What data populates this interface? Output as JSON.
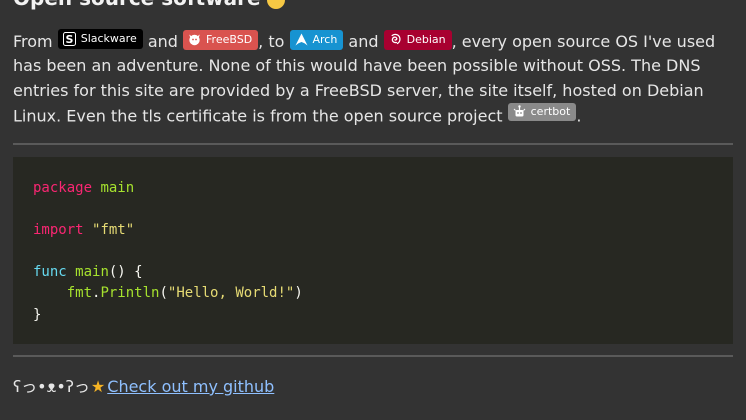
{
  "heading": {
    "text": "Open source software"
  },
  "paragraph": {
    "from": "From",
    "and1": "and",
    "comma_to": ", to",
    "and2": "and",
    "rest_line": ", every open source OS I've used has been an adventure. None of this would have been possible without OSS. The DNS entries for this site are provided by a FreeBSD server, the site itself, hosted on Debian Linux. Even the tls certificate is from the open source project",
    "period": "."
  },
  "badges": {
    "slackware": "Slackware",
    "freebsd": "FreeBSD",
    "arch": "Arch",
    "debian": "Debian",
    "certbot": "certbot"
  },
  "code": {
    "l1_kw": "package",
    "l1_name": "main",
    "l3_kw": "import",
    "l3_str": "\"fmt\"",
    "l5_kw": "func",
    "l5_fn": "main",
    "l5_rest": "() {",
    "l6_pkg": "fmt",
    "l6_dot": ".",
    "l6_fn": "Println",
    "l6_open": "(",
    "l6_str": "\"Hello, World!\"",
    "l6_close": ")",
    "l7": "}"
  },
  "footer": {
    "kaomoji": "ʕっ•ᴥ•ʔっ",
    "link_text": "Check out my github"
  },
  "colors": {
    "background": "#333333",
    "code_background": "#272822",
    "link": "#8fc0ff",
    "freebsd": "#d9534f",
    "arch": "#1793d1",
    "debian": "#a80030",
    "slackware": "#000000",
    "certbot": "#8a8a8a"
  }
}
